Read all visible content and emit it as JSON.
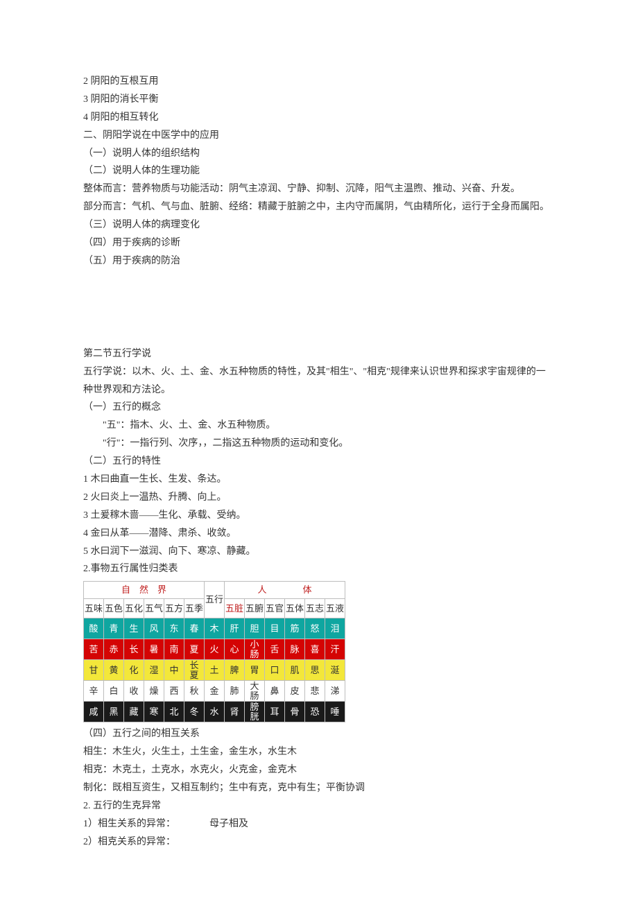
{
  "top_lines": [
    "2 阴阳的互根互用",
    "3 阴阳的消长平衡",
    "4 阴阳的相互转化",
    "二、阴阳学说在中医学中的应用",
    "（一）说明人体的组织结构",
    "（二）说明人体的生理功能",
    "整体而言：营养物质与功能活动：阴气主凉润、宁静、抑制、沉降，阳气主温煦、推动、兴奋、升发。",
    "部分而言：气机、气与血、脏腑、经络：精藏于脏腑之中，主内守而属阴，气由精所化，运行于全身而属阳。",
    "（三）说明人体的病理变化",
    "（四）用于疾病的诊断",
    "（五）用于疾病的防治"
  ],
  "mid_lines_1": [
    "第二节五行学说",
    "五行学说：以木、火、土、金、水五种物质的特性，及其\"相生\"、\"相克\"规律来认识世界和探求宇宙规律的一种世界观和方法论。",
    "（一）五行的概念"
  ],
  "mid_lines_2": [
    "\"五\"：指木、火、土、金、水五种物质。",
    "\"行\"：一指行列、次序，，二指这五种物质的运动和变化。"
  ],
  "mid_lines_3": [
    "（二）五行的特性",
    "1 木曰曲直一生长、生发、条达。",
    "2 火曰炎上一温热、升腾、向上。",
    "3 土爰稼木啬——生化、承载、受纳。",
    "4 金曰从革——潜降、肃杀、收敛。",
    "5 水曰润下一滋润、向下、寒凉、静藏。",
    "2.事物五行属性归类表"
  ],
  "table": {
    "group_left": "自　然　界",
    "group_center": "五行",
    "group_right": "人　　　　体",
    "headers": [
      "五味",
      "五色",
      "五化",
      "五气",
      "五方",
      "五季",
      "五行",
      "五脏",
      "五腑",
      "五官",
      "五体",
      "五志",
      "五液"
    ],
    "rows": [
      {
        "cls": "row-mu",
        "cells": [
          "酸",
          "青",
          "生",
          "风",
          "东",
          "春",
          "木",
          "肝",
          "胆",
          "目",
          "筋",
          "怒",
          "泪"
        ]
      },
      {
        "cls": "row-huo",
        "cells": [
          "苦",
          "赤",
          "长",
          "暑",
          "南",
          "夏",
          "火",
          "心",
          "小肠",
          "舌",
          "脉",
          "喜",
          "汗"
        ]
      },
      {
        "cls": "row-tu",
        "cells": [
          "甘",
          "黄",
          "化",
          "湿",
          "中",
          "长夏",
          "土",
          "脾",
          "胃",
          "口",
          "肌",
          "思",
          "涎"
        ]
      },
      {
        "cls": "row-jin",
        "cells": [
          "辛",
          "白",
          "收",
          "燥",
          "西",
          "秋",
          "金",
          "肺",
          "大肠",
          "鼻",
          "皮",
          "悲",
          "涕"
        ]
      },
      {
        "cls": "row-shui",
        "cells": [
          "咸",
          "黑",
          "藏",
          "寒",
          "北",
          "冬",
          "水",
          "肾",
          "膀胱",
          "耳",
          "骨",
          "恐",
          "唾"
        ]
      }
    ]
  },
  "bottom_lines": [
    "（四）五行之间的相互关系",
    "相生：木生火，火生土，土生金，金生水，水生木",
    "相克：木克土，土克水，水克火，火克金，金克木",
    "制化：既相互资生，又相互制约；生中有克，克中有生；平衡协调",
    "2. 五行的生克异常",
    "1）相生关系的异常：　　　　母子相及",
    "2）相克关系的异常："
  ]
}
